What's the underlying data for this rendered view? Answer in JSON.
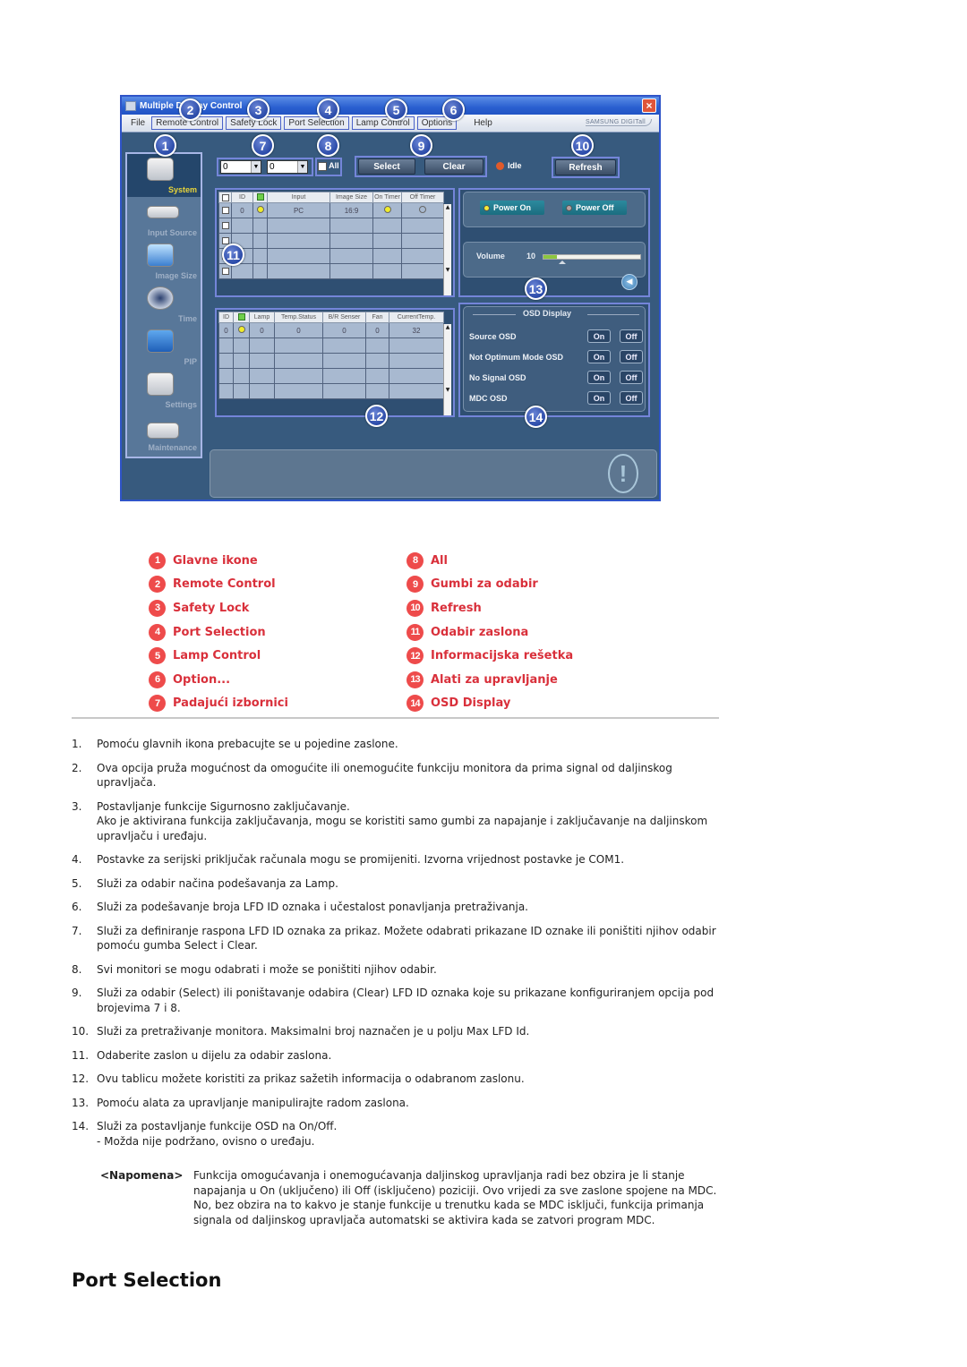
{
  "app": {
    "window_title": "Multiple Display Control",
    "close_label": "×",
    "menu": [
      "File",
      "Remote Control",
      "Safety Lock",
      "Port Selection",
      "Lamp Control",
      "Options",
      "Help"
    ],
    "brand": "SAMSUNG DIGITall",
    "sidebar": [
      {
        "label": "System",
        "icon": "system-icon",
        "active": true
      },
      {
        "label": "Input Source",
        "icon": "input-source-icon"
      },
      {
        "label": "Image Size",
        "icon": "image-size-icon"
      },
      {
        "label": "Time",
        "icon": "time-icon"
      },
      {
        "label": "PIP",
        "icon": "pip-icon"
      },
      {
        "label": "Settings",
        "icon": "settings-icon"
      },
      {
        "label": "Maintenance",
        "icon": "maintenance-icon"
      }
    ],
    "toolbar": {
      "range_from": "0",
      "range_to": "0",
      "all_label": "All",
      "select_label": "Select",
      "clear_label": "Clear",
      "status": "Idle",
      "refresh_label": "Refresh"
    },
    "top_grid": {
      "headers": [
        "ID",
        "",
        "Input",
        "Image Size",
        "On Timer",
        "Off Timer"
      ],
      "rows": [
        {
          "id": "0",
          "input": "PC",
          "image_size": "16:9"
        }
      ],
      "empty_rows": 4
    },
    "bottom_grid": {
      "headers": [
        "ID",
        "",
        "Lamp",
        "Temp.Status",
        "B/R Senser",
        "Fan",
        "CurrentTemp."
      ],
      "rows": [
        {
          "id": "0",
          "lamp": "0",
          "temp_status": "0",
          "br_sensor": "0",
          "fan": "0",
          "current_temp": "32"
        }
      ],
      "empty_rows": 4
    },
    "power": {
      "on_label": "Power On",
      "off_label": "Power Off"
    },
    "volume": {
      "label": "Volume",
      "value": "10",
      "level_fraction": 0.1
    },
    "osd": {
      "title": "OSD Display",
      "on_label": "On",
      "off_label": "Off",
      "rows": [
        "Source OSD",
        "Not Optimum Mode OSD",
        "No Signal OSD",
        "MDC OSD"
      ]
    },
    "callouts": [
      "1",
      "2",
      "3",
      "4",
      "5",
      "6",
      "7",
      "8",
      "9",
      "10",
      "11",
      "12",
      "13",
      "14"
    ]
  },
  "legend": {
    "left": [
      {
        "n": "1",
        "label": "Glavne ikone"
      },
      {
        "n": "2",
        "label": "Remote Control"
      },
      {
        "n": "3",
        "label": "Safety Lock"
      },
      {
        "n": "4",
        "label": "Port Selection"
      },
      {
        "n": "5",
        "label": "Lamp Control"
      },
      {
        "n": "6",
        "label": "Option..."
      },
      {
        "n": "7",
        "label": "Padajući izbornici"
      }
    ],
    "right": [
      {
        "n": "8",
        "label": "All"
      },
      {
        "n": "9",
        "label": "Gumbi za odabir"
      },
      {
        "n": "10",
        "label": "Refresh"
      },
      {
        "n": "11",
        "label": "Odabir zaslona"
      },
      {
        "n": "12",
        "label": "Informacijska rešetka"
      },
      {
        "n": "13",
        "label": "Alati za upravljanje"
      },
      {
        "n": "14",
        "label": "OSD Display"
      }
    ]
  },
  "steps": [
    {
      "n": "1.",
      "lines": [
        "Pomoću glavnih ikona prebacujte se u pojedine zaslone."
      ]
    },
    {
      "n": "2.",
      "lines": [
        "Ova opcija pruža mogućnost da omogućite ili onemogućite funkciju monitora da prima signal od daljinskog upravljača."
      ]
    },
    {
      "n": "3.",
      "lines": [
        "Postavljanje funkcije Sigurnosno zaključavanje.",
        "Ako je aktivirana funkcija zaključavanja, mogu se koristiti samo gumbi za napajanje i zaključavanje na daljinskom upravljaču i uređaju."
      ]
    },
    {
      "n": "4.",
      "lines": [
        "Postavke za serijski priključak računala mogu se promijeniti. Izvorna vrijednost postavke je COM1."
      ]
    },
    {
      "n": "5.",
      "lines": [
        "Služi za odabir načina podešavanja za Lamp."
      ]
    },
    {
      "n": "6.",
      "lines": [
        "Služi za podešavanje broja LFD ID oznaka i učestalost ponavljanja pretraživanja."
      ]
    },
    {
      "n": "7.",
      "lines": [
        "Služi za definiranje raspona LFD ID oznaka za prikaz. Možete odabrati prikazane ID oznake ili poništiti njihov odabir pomoću gumba Select i Clear."
      ]
    },
    {
      "n": "8.",
      "lines": [
        "Svi monitori se mogu odabrati i može se poništiti njihov odabir."
      ]
    },
    {
      "n": "9.",
      "lines": [
        "Služi za odabir (Select) ili poništavanje odabira (Clear) LFD ID oznaka koje su prikazane konfiguriranjem opcija pod brojevima 7 i 8."
      ]
    },
    {
      "n": "10.",
      "lines": [
        "Služi za pretraživanje monitora. Maksimalni broj naznačen je u polju Max LFD Id."
      ]
    },
    {
      "n": "11.",
      "lines": [
        "Odaberite zaslon u dijelu za odabir zaslona."
      ]
    },
    {
      "n": "12.",
      "lines": [
        "Ovu tablicu možete koristiti za prikaz sažetih informacija o odabranom zaslonu."
      ]
    },
    {
      "n": "13.",
      "lines": [
        "Pomoću alata za upravljanje manipulirajte radom zaslona."
      ]
    },
    {
      "n": "14.",
      "lines": [
        "Služi za postavljanje funkcije OSD na On/Off.",
        " - Možda nije podržano, ovisno o uređaju."
      ]
    }
  ],
  "note": {
    "tag": "<Napomena>",
    "text": "Funkcija omogućavanja i onemogućavanja daljinskog upravljanja radi bez obzira je li stanje napajanja u On (uključeno) ili Off (isključeno) poziciji. Ovo vrijedi za sve zaslone spojene na MDC. No, bez obzira na to kakvo je stanje funkcije u trenutku kada se MDC isključi, funkcija primanja signala od daljinskog upravljača automatski se aktivira kada se zatvori program MDC."
  },
  "section_heading": "Port Selection",
  "colors": {
    "legend_text": "#d9303b",
    "legend_badge": "#ee4b4b",
    "app_bg": "#375a7e"
  }
}
